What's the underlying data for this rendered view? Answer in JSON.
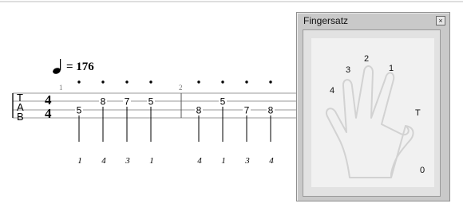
{
  "score": {
    "tempo": "= 176",
    "clef_letters": [
      "T",
      "A",
      "B"
    ],
    "time_signature": [
      "4",
      "4"
    ],
    "measures": [
      {
        "number": "1",
        "notes": [
          {
            "fret": "5",
            "string": 2,
            "finger": "1"
          },
          {
            "fret": "8",
            "string": 1,
            "finger": "4"
          },
          {
            "fret": "7",
            "string": 1,
            "finger": "3"
          },
          {
            "fret": "5",
            "string": 1,
            "finger": "1"
          }
        ]
      },
      {
        "number": "2",
        "notes": [
          {
            "fret": "8",
            "string": 2,
            "finger": "4"
          },
          {
            "fret": "5",
            "string": 1,
            "finger": "1"
          },
          {
            "fret": "7",
            "string": 2,
            "finger": "3"
          },
          {
            "fret": "8",
            "string": 2,
            "finger": "4"
          }
        ]
      }
    ]
  },
  "panel": {
    "title": "Fingersatz",
    "close_symbol": "×",
    "finger_labels": {
      "index_1": "1",
      "middle_2": "2",
      "ring_3": "3",
      "little_4": "4",
      "thumb": "T",
      "open": "0"
    }
  }
}
